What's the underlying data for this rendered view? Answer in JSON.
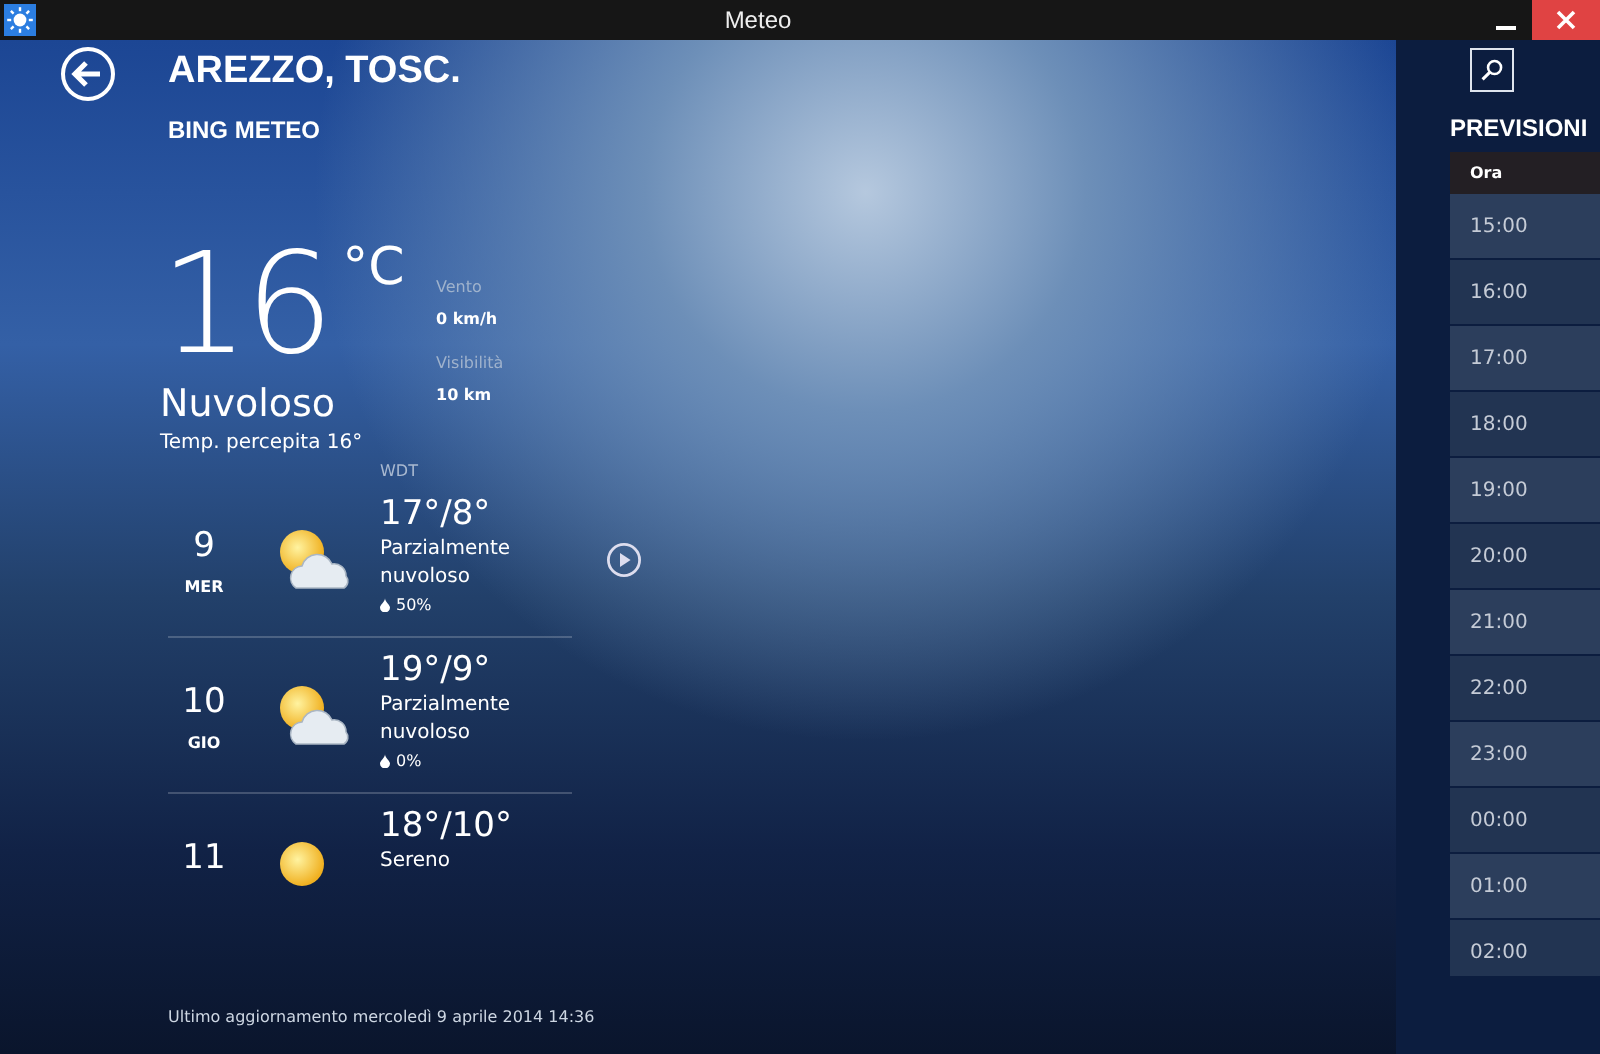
{
  "window": {
    "title": "Meteo"
  },
  "location": {
    "title": "AREZZO, TOSC.",
    "provider": "BING METEO"
  },
  "current": {
    "temperature": "16",
    "unit": "°C",
    "condition": "Nuvoloso",
    "feels_like": "Temp. percepita 16°",
    "details": [
      {
        "label": "Vento",
        "value": "0 km/h"
      },
      {
        "label": "Visibilità",
        "value": "10 km"
      }
    ]
  },
  "forecast": {
    "source": "WDT",
    "days": [
      {
        "day": "9",
        "weekday": "MER",
        "kind": "partly-cloudy",
        "temps": "17°/8°",
        "condition": "Parzialmente nuvoloso",
        "precipitation": "50%"
      },
      {
        "day": "10",
        "weekday": "GIO",
        "kind": "partly-cloudy",
        "temps": "19°/9°",
        "condition": "Parzialmente nuvoloso",
        "precipitation": "0%"
      },
      {
        "day": "11",
        "kind": "sunny",
        "temps": "18°/10°",
        "condition": "Sereno"
      }
    ]
  },
  "last_update": "Ultimo aggiornamento mercoledì 9 aprile 2014 14:36",
  "hourly": {
    "title": "PREVISIONI",
    "columns": [
      "Ora"
    ],
    "rows": [
      "15:00",
      "16:00",
      "17:00",
      "18:00",
      "19:00",
      "20:00",
      "21:00",
      "22:00",
      "23:00",
      "00:00",
      "01:00",
      "02:00"
    ]
  }
}
